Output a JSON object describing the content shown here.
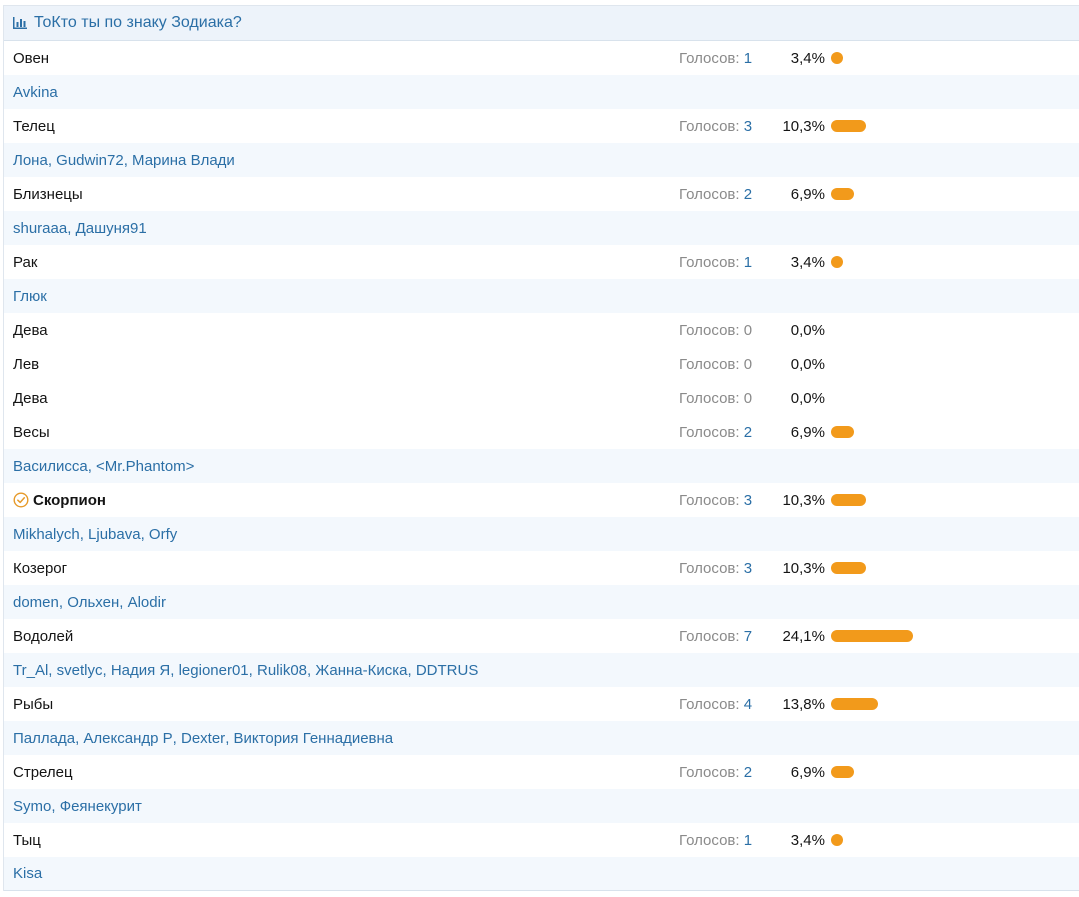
{
  "poll": {
    "title": "ТоКто ты по знаку Зодиака?",
    "votes_label": "Голосов:",
    "accent_color": "#2b6fa6",
    "bar_color": "#f29a1b",
    "icons": {
      "header": "bar-chart-icon",
      "voted": "check-circle-icon"
    },
    "options": [
      {
        "label": "Овен",
        "votes": "1",
        "percent": "3,4%",
        "fraction": 0.034,
        "voted": false,
        "voters": [
          "Avkina"
        ]
      },
      {
        "label": "Телец",
        "votes": "3",
        "percent": "10,3%",
        "fraction": 0.103,
        "voted": false,
        "voters": [
          "Лона",
          "Gudwin72",
          "Марина Влади"
        ]
      },
      {
        "label": "Близнецы",
        "votes": "2",
        "percent": "6,9%",
        "fraction": 0.069,
        "voted": false,
        "voters": [
          "shuraaa",
          "Дашуня91"
        ]
      },
      {
        "label": "Рак",
        "votes": "1",
        "percent": "3,4%",
        "fraction": 0.034,
        "voted": false,
        "voters": [
          "Глюк"
        ]
      },
      {
        "label": "Дева",
        "votes": "0",
        "percent": "0,0%",
        "fraction": 0,
        "voted": false,
        "voters": []
      },
      {
        "label": "Лев",
        "votes": "0",
        "percent": "0,0%",
        "fraction": 0,
        "voted": false,
        "voters": []
      },
      {
        "label": "Дева",
        "votes": "0",
        "percent": "0,0%",
        "fraction": 0,
        "voted": false,
        "voters": []
      },
      {
        "label": "Весы",
        "votes": "2",
        "percent": "6,9%",
        "fraction": 0.069,
        "voted": false,
        "voters": [
          "Василисса",
          "<Mr.Phantom>"
        ]
      },
      {
        "label": "Скорпион",
        "votes": "3",
        "percent": "10,3%",
        "fraction": 0.103,
        "voted": true,
        "voters": [
          "Mikhalych",
          "Ljubava",
          "Orfy"
        ]
      },
      {
        "label": "Козерог",
        "votes": "3",
        "percent": "10,3%",
        "fraction": 0.103,
        "voted": false,
        "voters": [
          "domen",
          "Ольхен",
          "Alodir"
        ]
      },
      {
        "label": "Водолей",
        "votes": "7",
        "percent": "24,1%",
        "fraction": 0.241,
        "voted": false,
        "voters": [
          "Tr_Al",
          "svetlyc",
          "Надия Я",
          "legioner01",
          "Rulik08",
          "Жанна-Киска",
          "DDTRUS"
        ]
      },
      {
        "label": "Рыбы",
        "votes": "4",
        "percent": "13,8%",
        "fraction": 0.138,
        "voted": false,
        "voters": [
          "Паллада",
          "Александр Р",
          "Dexter",
          "Виктория Геннадиевна"
        ]
      },
      {
        "label": "Стрелец",
        "votes": "2",
        "percent": "6,9%",
        "fraction": 0.069,
        "voted": false,
        "voters": [
          "Symo",
          "Феянекурит"
        ]
      },
      {
        "label": "Тыц",
        "votes": "1",
        "percent": "3,4%",
        "fraction": 0.034,
        "voted": false,
        "voters": [
          "Kisa"
        ]
      }
    ]
  }
}
